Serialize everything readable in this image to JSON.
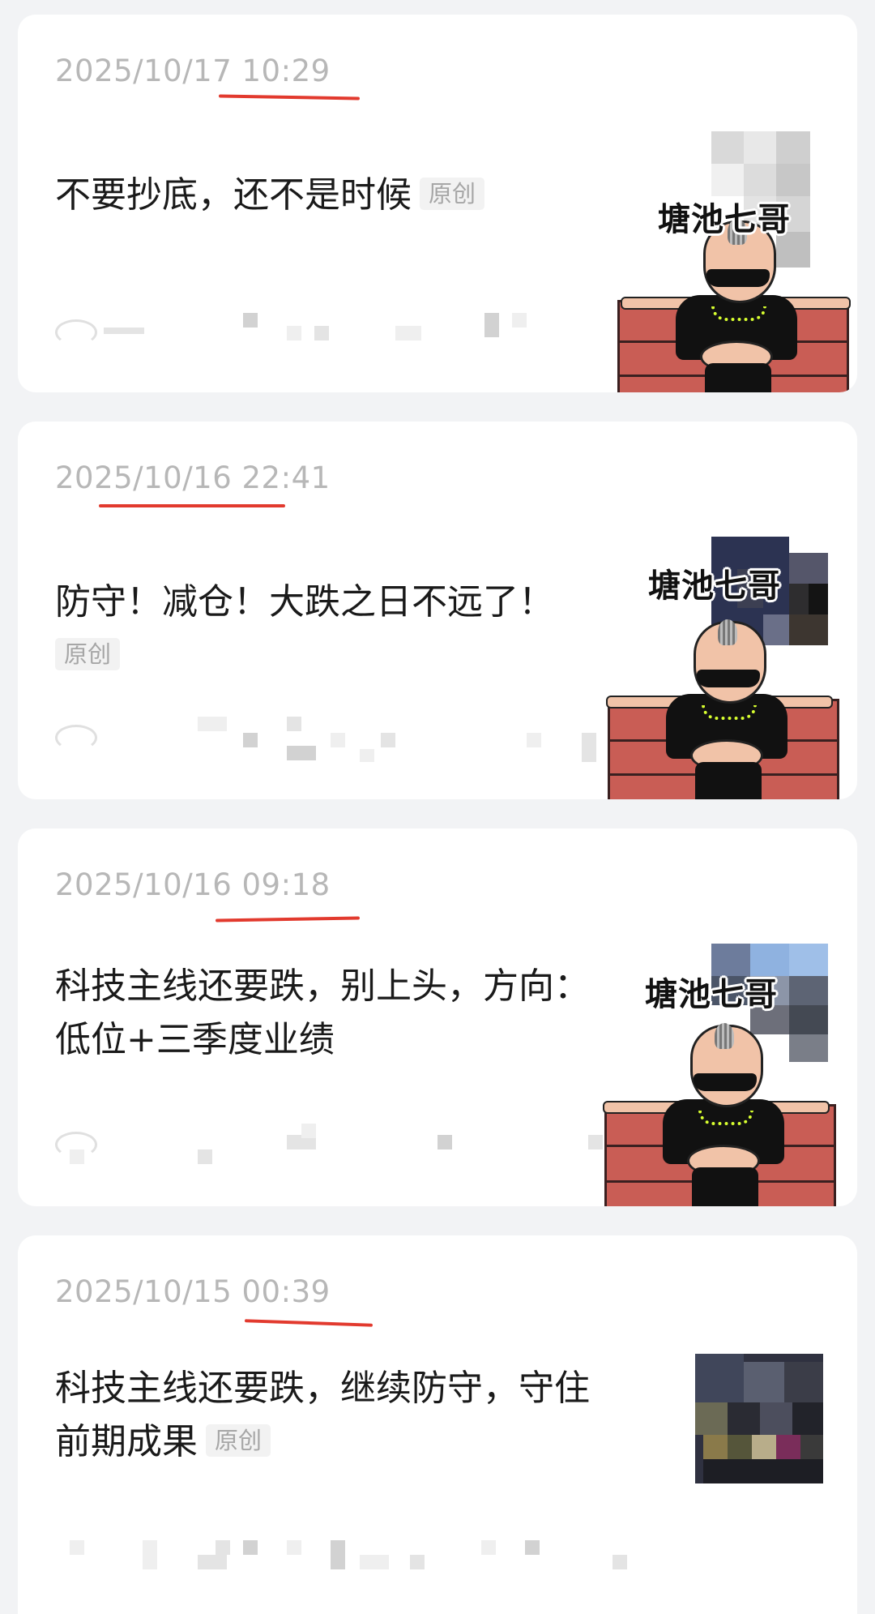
{
  "articles": [
    {
      "date": "2025/10/17 10:29",
      "title": "不要抄底，还不是时候",
      "tag": "原创",
      "thumb_caption": "塘池七哥"
    },
    {
      "date": "2025/10/16 22:41",
      "title": "防守！减仓！大跌之日不远了！",
      "tag": "原创",
      "thumb_caption": "塘池七哥"
    },
    {
      "date": "2025/10/16 09:18",
      "title_line1": "科技主线还要跌，别上头，方向：",
      "title_line2": "低位+三季度业绩",
      "thumb_caption": "塘池七哥"
    },
    {
      "date": "2025/10/15 00:39",
      "title_line1": "科技主线还要跌，继续防守，守住",
      "title_line2": "前期成果",
      "tag": "原创"
    }
  ],
  "icons": {
    "stats": "eye-icon"
  },
  "colors": {
    "background": "#f2f3f5",
    "card": "#ffffff",
    "annotation": "#e23a2e",
    "date": "#b7b7b7"
  }
}
